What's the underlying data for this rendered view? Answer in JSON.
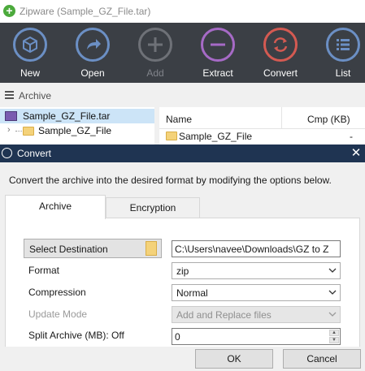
{
  "window": {
    "title": "Zipware (Sample_GZ_File.tar)"
  },
  "toolbar": {
    "buttons": [
      {
        "label": "New",
        "icon": "cube-icon",
        "enabled": true
      },
      {
        "label": "Open",
        "icon": "arrow-right-icon",
        "enabled": true
      },
      {
        "label": "Add",
        "icon": "plus-icon",
        "enabled": false
      },
      {
        "label": "Extract",
        "icon": "minus-icon",
        "enabled": true
      },
      {
        "label": "Convert",
        "icon": "convert-arrows-icon",
        "enabled": true
      },
      {
        "label": "List",
        "icon": "list-icon",
        "enabled": true
      }
    ]
  },
  "archive_bar": {
    "label": "Archive"
  },
  "tree": {
    "root": "Sample_GZ_File.tar",
    "child": "Sample_GZ_File"
  },
  "file_list": {
    "columns": [
      "Name",
      "Cmp (KB)"
    ],
    "rows": [
      {
        "name": "Sample_GZ_File",
        "cmp": "-"
      }
    ]
  },
  "dialog": {
    "title": "Convert",
    "close_glyph": "✕",
    "description": "Convert the archive into the desired format by modifying the options below.",
    "tabs": [
      "Archive",
      "Encryption"
    ],
    "active_tab": "Archive",
    "select_destination_label": "Select Destination",
    "destination_value": "C:\\Users\\navee\\Downloads\\GZ to Z",
    "format": {
      "label": "Format",
      "value": "zip"
    },
    "compression": {
      "label": "Compression",
      "value": "Normal"
    },
    "update_mode": {
      "label": "Update Mode",
      "value": "Add and Replace files",
      "enabled": false
    },
    "split_archive": {
      "label": "Split Archive (MB): Off",
      "value": "0"
    },
    "ok_label": "OK",
    "cancel_label": "Cancel"
  },
  "colors": {
    "toolbar_bg": "#3b3f45",
    "dialog_title_bg": "#1f3452",
    "button_ring_blue": "#6b8fc4",
    "extract_ring": "#a66ac6",
    "convert_ring": "#d45a52",
    "selection_bg": "#cce4f7",
    "app_icon_green": "#4caa3c"
  }
}
